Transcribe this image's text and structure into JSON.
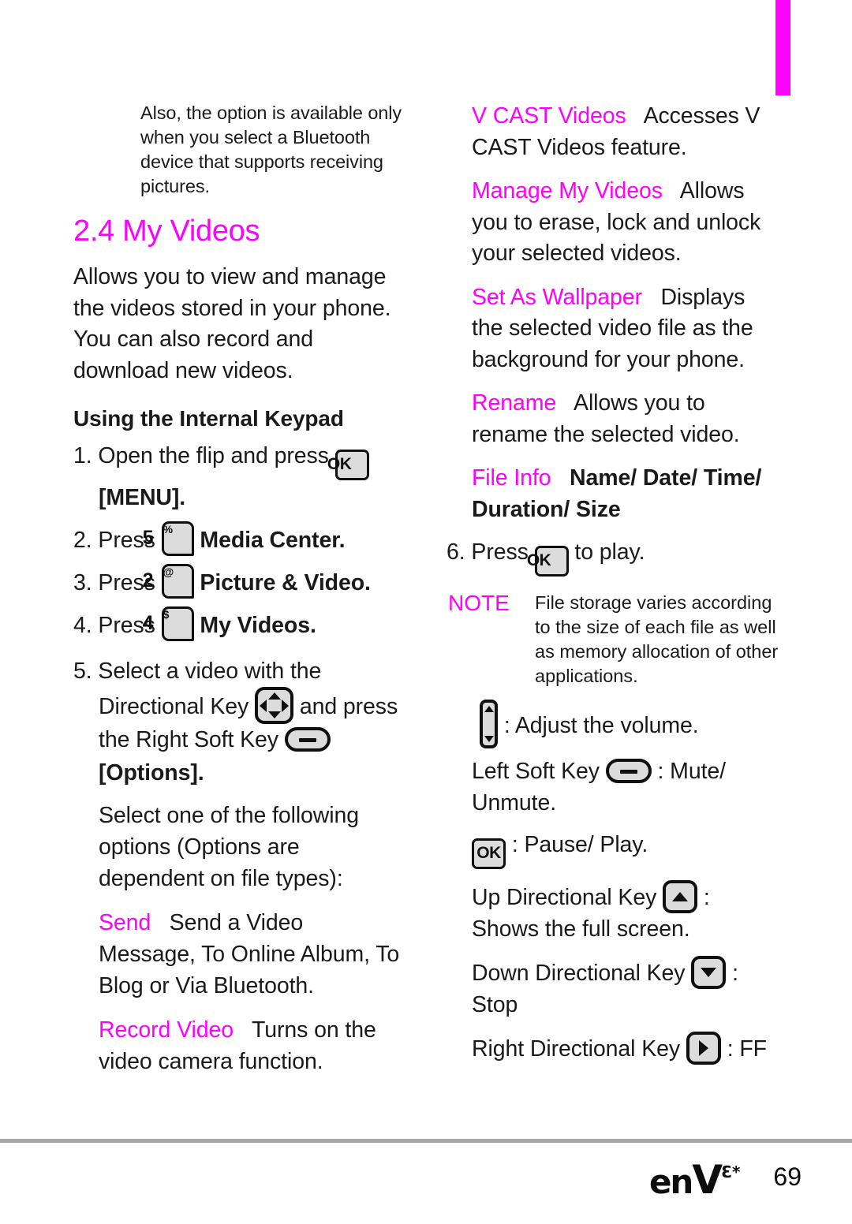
{
  "colors": {
    "accent": "#FF00FF",
    "text": "#1A1A1A",
    "key_fill": "#DCDCDC",
    "key_border": "#101010",
    "footer_rule": "#A6A6A6"
  },
  "tab_marker": {
    "name": "chapter-tab-marker",
    "color": "#FF00FF"
  },
  "left_column": {
    "intro_note": "Also, the option is available only when you select a Bluetooth device that supports receiving pictures.",
    "section_heading": "2.4 My Videos",
    "section_body": "Allows you to view and manage the videos stored in your phone. You can also record and download new videos.",
    "subheading": "Using the Internal Keypad",
    "steps": [
      {
        "number": "1.",
        "text_before": "Open the flip and press",
        "key": "OK",
        "text_after": "[MENU].",
        "after_bold": true
      },
      {
        "number": "2.",
        "text_before": "Press",
        "key_digit": "5",
        "key_sup": "%",
        "text_after": "Media Center.",
        "after_bold": true
      },
      {
        "number": "3.",
        "text_before": "Press",
        "key_digit": "2",
        "key_sup": "@",
        "text_after": "Picture & Video.",
        "after_bold": true
      },
      {
        "number": "4.",
        "text_before": "Press",
        "key_digit": "4",
        "key_sup": "$",
        "text_after": "My Videos.",
        "after_bold": true
      }
    ],
    "step5": {
      "number": "5.",
      "part1": "Select a video with the Directional Key",
      "part2": "and press the Right Soft Key",
      "part3": "[Options].",
      "dpad_icon": "directional-pad-icon",
      "softkey_icon": "soft-key-icon"
    },
    "options_intro": "Select one of the following options (Options are dependent on file types):",
    "options": [
      {
        "term": "Send",
        "desc": "Send a Video Message, To Online Album, To Blog or Via Bluetooth."
      },
      {
        "term": "Record Video",
        "desc": "Turns on the video camera function."
      }
    ]
  },
  "right_column": {
    "options": [
      {
        "term": "V CAST Videos",
        "desc": "Accesses V CAST Videos feature."
      },
      {
        "term": "Manage My Videos",
        "desc": "Allows you to erase, lock and unlock your selected videos."
      },
      {
        "term": "Set As Wallpaper",
        "desc": "Displays the selected video file as the background for your phone."
      },
      {
        "term": "Rename",
        "desc": "Allows you to rename the selected video."
      },
      {
        "term": "File Info",
        "desc": "Name/ Date/ Time/ Duration/ Size",
        "desc_bold": true
      }
    ],
    "step6": {
      "number": "6.",
      "text_before": "Press",
      "key": "OK",
      "text_after": "to play."
    },
    "note": {
      "label": "NOTE",
      "text": "File storage varies according to the size of each file as well as memory allocation of other applications."
    },
    "key_actions": [
      {
        "icon": "volume-rocker-icon",
        "label_before": "",
        "label_after": ": Adjust the volume."
      },
      {
        "icon": "soft-key-icon",
        "label_before": "Left Soft Key",
        "label_after": ": Mute/ Unmute."
      },
      {
        "icon": "ok-key-icon",
        "label_before": "",
        "label_after": ": Pause/ Play."
      },
      {
        "icon": "up-directional-key-icon",
        "label_before": "Up Directional Key",
        "label_after": ": Shows the full screen."
      },
      {
        "icon": "down-directional-key-icon",
        "label_before": "Down Directional Key",
        "label_after": ": Stop"
      },
      {
        "icon": "right-directional-key-icon",
        "label_before": "Right Directional Key",
        "label_after": ": FF"
      }
    ]
  },
  "footer": {
    "logo_en": "en",
    "logo_v": "V",
    "logo_sup": "*3",
    "page_number": "69"
  }
}
